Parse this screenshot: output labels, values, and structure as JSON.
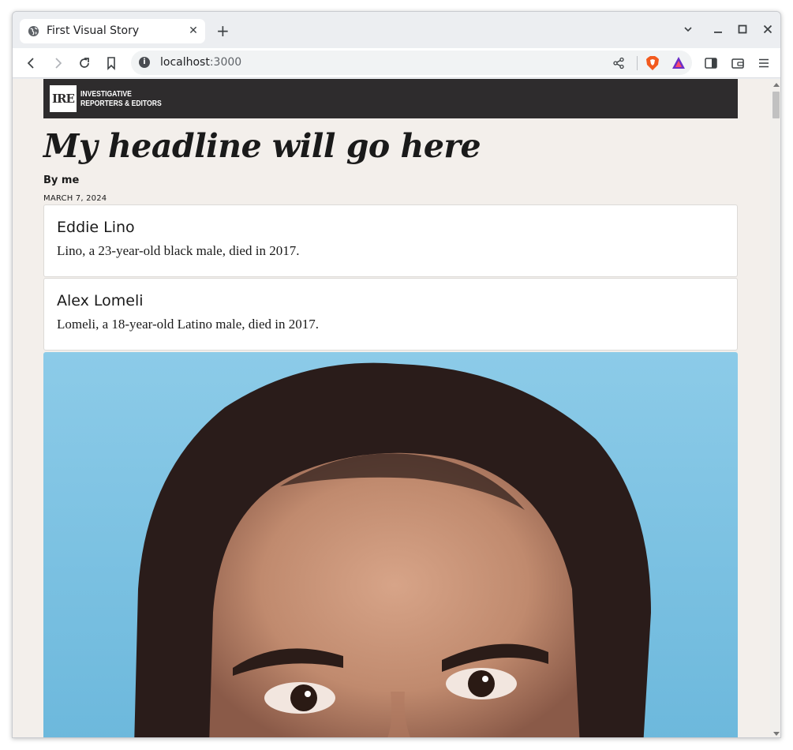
{
  "browser": {
    "tab_title": "First Visual Story",
    "tab_close": "✕",
    "new_tab": "+",
    "url_host": "localhost",
    "url_port": ":3000",
    "info_glyph": "i",
    "icons": [
      "globe-icon",
      "back-icon",
      "forward-icon",
      "reload-icon",
      "bookmark-icon",
      "info-icon",
      "share-icon",
      "brave-shields-icon",
      "brave-rewards-icon",
      "sidebar-icon",
      "wallet-icon",
      "menu-icon",
      "tab-search-icon",
      "minimize-icon",
      "maximize-icon",
      "close-icon"
    ]
  },
  "page": {
    "logo_mark": "IRE",
    "logo_line1": "INVESTIGATIVE",
    "logo_line2": "REPORTERS & EDITORS",
    "headline": "My headline will go here",
    "byline": "By me",
    "date": "MARCH 7, 2024",
    "cards": [
      {
        "name": "Eddie Lino",
        "description": "Lino, a 23-year-old black male, died in 2017."
      },
      {
        "name": "Alex Lomeli",
        "description": "Lomeli, a 18-year-old Latino male, died in 2017."
      }
    ]
  },
  "colors": {
    "masthead": "#2e2c2d",
    "page_background": "#f3efeb",
    "photo_background": "#7ec3e3"
  }
}
